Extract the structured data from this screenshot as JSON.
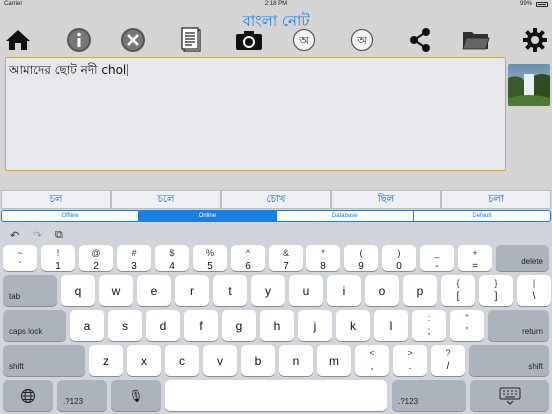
{
  "status": {
    "carrier": "Carrier",
    "time": "2:18 PM",
    "battery": "99%"
  },
  "title": "বাংলা নোট",
  "toolbar": [
    {
      "name": "home-icon"
    },
    {
      "name": "info-icon"
    },
    {
      "name": "close-icon"
    },
    {
      "name": "document-icon"
    },
    {
      "name": "camera-icon"
    },
    {
      "name": "bangla-a-icon",
      "glyph": "অ"
    },
    {
      "name": "bangla-a-alt-icon",
      "glyph": "অ"
    },
    {
      "name": "share-icon"
    },
    {
      "name": "folder-icon"
    },
    {
      "name": "gear-icon"
    }
  ],
  "editor": {
    "text": "আমাদের ছোট নদী chol"
  },
  "suggestions": [
    "চল",
    "চলে",
    "চোখ",
    "ছিল",
    "চলা"
  ],
  "segments": [
    {
      "label": "Offline",
      "selected": false
    },
    {
      "label": "Online",
      "selected": true
    },
    {
      "label": "Database",
      "selected": false
    },
    {
      "label": "Default",
      "selected": false
    }
  ],
  "keyboard": {
    "undo": "↶",
    "redo": "↷",
    "paste": "⧉",
    "row1": [
      [
        "~",
        "`"
      ],
      [
        "!",
        "1"
      ],
      [
        "@",
        "2"
      ],
      [
        "#",
        "3"
      ],
      [
        "$",
        "4"
      ],
      [
        "%",
        "5"
      ],
      [
        "^",
        "6"
      ],
      [
        "&",
        "7"
      ],
      [
        "*",
        "8"
      ],
      [
        "(",
        "9"
      ],
      [
        ")",
        "0"
      ],
      [
        "_",
        "-"
      ],
      [
        "+",
        "="
      ]
    ],
    "delete": "delete",
    "tab": "tab",
    "row2": [
      "q",
      "w",
      "e",
      "r",
      "t",
      "y",
      "u",
      "i",
      "o",
      "p"
    ],
    "row2sym": [
      [
        "{",
        "["
      ],
      [
        "}",
        "]"
      ],
      [
        "|",
        "\\"
      ]
    ],
    "caps": "caps lock",
    "row3": [
      "a",
      "s",
      "d",
      "f",
      "g",
      "h",
      "j",
      "k",
      "l"
    ],
    "row3sym": [
      [
        ":",
        ";"
      ],
      [
        "\"",
        "'"
      ]
    ],
    "return": "return",
    "shift": "shift",
    "row4": [
      "z",
      "x",
      "c",
      "v",
      "b",
      "n",
      "m"
    ],
    "row4sym": [
      [
        "<",
        ","
      ],
      [
        ">",
        "."
      ],
      [
        "?",
        "/"
      ]
    ],
    "numkey": ".?123",
    "mic": "🎙"
  }
}
